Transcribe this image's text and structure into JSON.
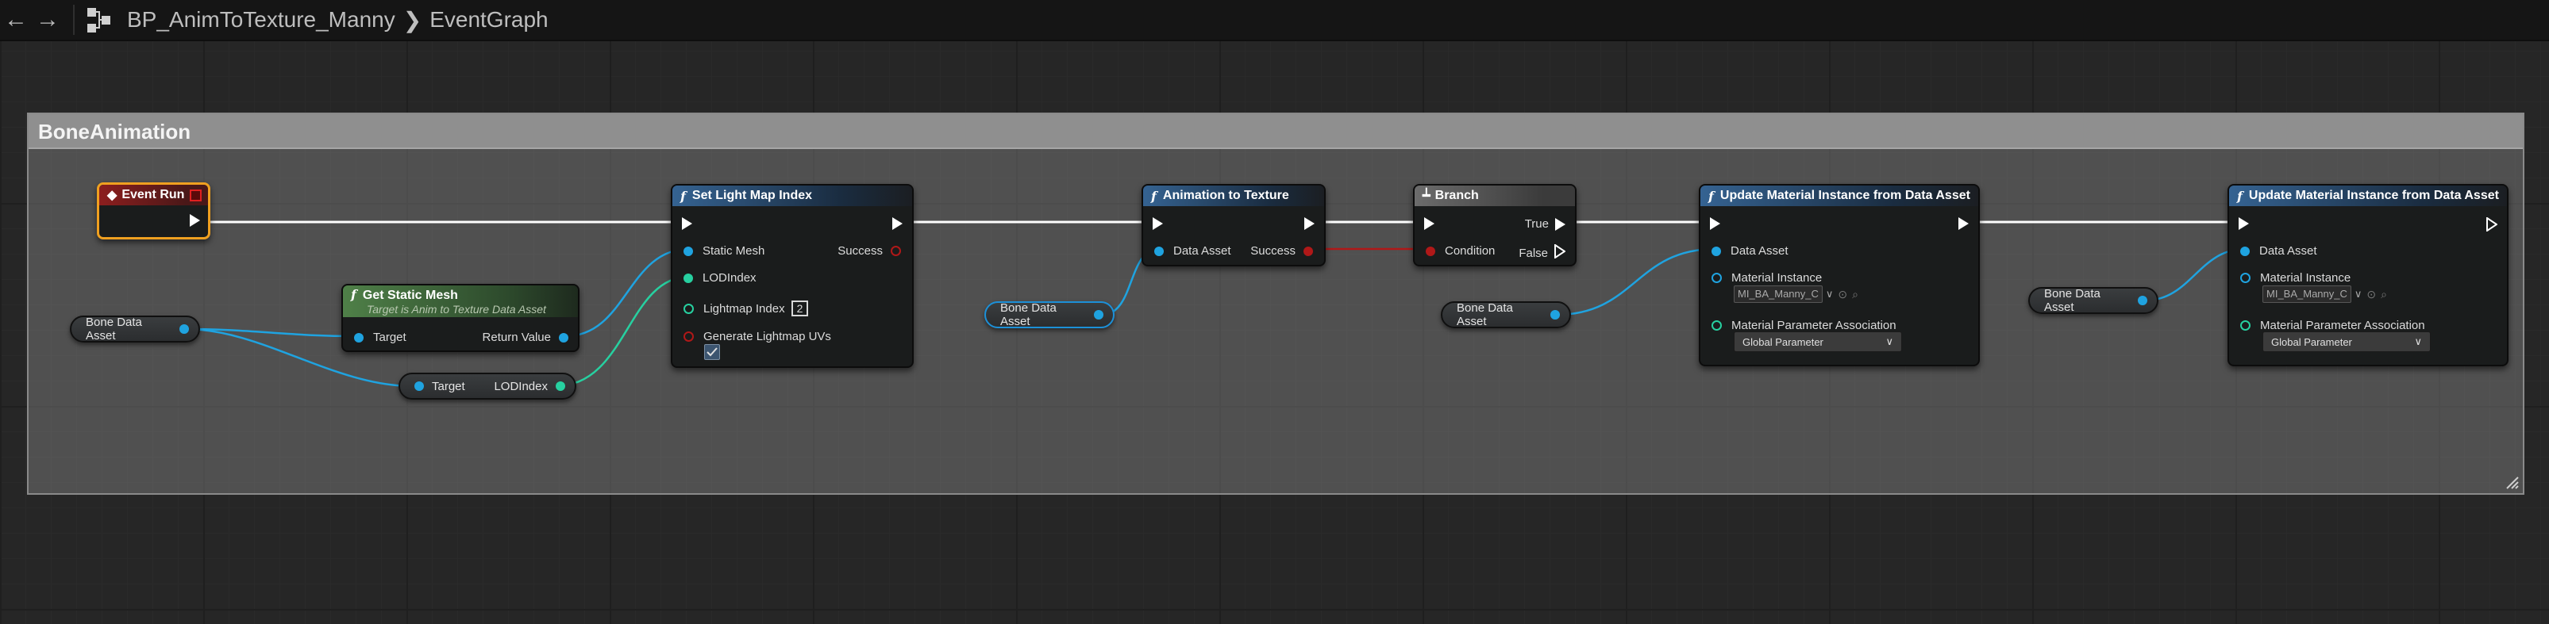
{
  "topbar": {
    "breadcrumb_blueprint": "BP_AnimToTexture_Manny",
    "breadcrumb_graph": "EventGraph",
    "back_icon": "arrow-left-icon",
    "forward_icon": "arrow-right-icon"
  },
  "comment": {
    "title": "BoneAnimation"
  },
  "nodes": {
    "event_run": {
      "title": "Event Run"
    },
    "get_static_mesh": {
      "title": "Get Static Mesh",
      "subtitle": "Target is Anim to Texture Data Asset",
      "pin_target": "Target",
      "pin_return": "Return Value"
    },
    "break_var": {
      "pin_target": "Target",
      "pin_lod": "LODIndex"
    },
    "set_light_map": {
      "title": "Set Light Map Index",
      "pin_static_mesh": "Static Mesh",
      "pin_lod": "LODIndex",
      "pin_lightmap_index": "Lightmap Index",
      "lightmap_index_value": "2",
      "pin_generate": "Generate Lightmap UVs",
      "pin_success": "Success"
    },
    "anim_to_texture": {
      "title": "Animation to Texture",
      "pin_data_asset": "Data Asset",
      "pin_success": "Success"
    },
    "branch": {
      "title": "Branch",
      "pin_condition": "Condition",
      "pin_true": "True",
      "pin_false": "False"
    },
    "update_1": {
      "title": "Update Material Instance from Data Asset",
      "pin_data_asset": "Data Asset",
      "pin_material_instance": "Material Instance",
      "material_instance_value": "MI_BA_Manny_C",
      "pin_assoc": "Material Parameter Association",
      "assoc_value": "Global Parameter"
    },
    "update_2": {
      "title": "Update Material Instance from Data Asset",
      "pin_data_asset": "Data Asset",
      "pin_material_instance": "Material Instance",
      "material_instance_value": "MI_BA_Manny_C",
      "pin_assoc": "Material Parameter Association",
      "assoc_value": "Global Parameter"
    }
  },
  "variables": {
    "bone_data_asset_1": "Bone Data Asset",
    "bone_data_asset_2": "Bone Data Asset",
    "bone_data_asset_3": "Bone Data Asset",
    "bone_data_asset_4": "Bone Data Asset"
  },
  "colors": {
    "exec_wire": "#ffffff",
    "object_wire": "#1fa3e0",
    "int_wire": "#27d0a0",
    "bool_wire": "#b01818",
    "function_header": "#356392",
    "pure_header": "#4f8048",
    "event_header": "#8c1e1e"
  }
}
